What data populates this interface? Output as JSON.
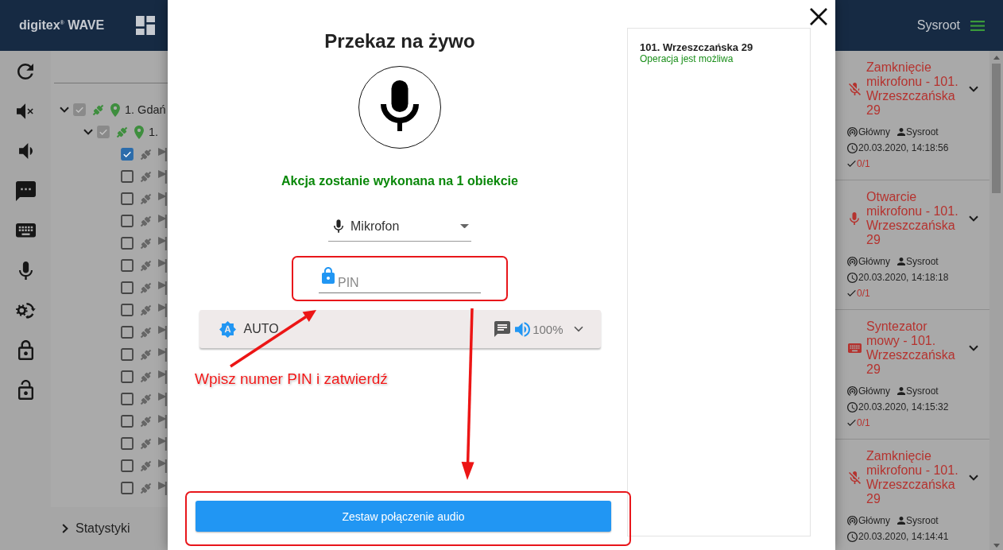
{
  "header": {
    "logo": "digitex$^{®}$ WAVE",
    "user": "Sysroot"
  },
  "tree": [
    {
      "label": "1. Gdań",
      "kind": "location",
      "color": "#3e8e3e",
      "checked": true,
      "disabled": true,
      "expanded": true,
      "children": [
        {
          "label": "1.",
          "kind": "location",
          "color": "#3e8e3e",
          "checked": true,
          "disabled": true,
          "expanded": true,
          "children": [
            {
              "kind": "device",
              "color": "#666666",
              "checked": true,
              "disabled": false
            },
            {
              "kind": "device",
              "color": "#666666",
              "checked": false,
              "disabled": false
            },
            {
              "kind": "device",
              "color": "#666666",
              "checked": false,
              "disabled": false
            },
            {
              "kind": "device",
              "color": "#666666",
              "checked": false,
              "disabled": false
            },
            {
              "kind": "device",
              "color": "#666666",
              "checked": false,
              "disabled": false
            },
            {
              "kind": "device",
              "color": "#666666",
              "checked": false,
              "disabled": false
            },
            {
              "kind": "device",
              "color": "#666666",
              "checked": false,
              "disabled": false
            },
            {
              "kind": "device",
              "color": "#666666",
              "checked": false,
              "disabled": false
            },
            {
              "kind": "device",
              "color": "#666666",
              "checked": false,
              "disabled": false
            },
            {
              "kind": "device",
              "color": "#666666",
              "checked": false,
              "disabled": false
            },
            {
              "kind": "device",
              "color": "#666666",
              "checked": false,
              "disabled": false
            },
            {
              "kind": "device",
              "color": "#666666",
              "checked": false,
              "disabled": false
            },
            {
              "kind": "device",
              "color": "#666666",
              "checked": false,
              "disabled": false
            },
            {
              "kind": "device",
              "color": "#666666",
              "checked": false,
              "disabled": false
            },
            {
              "kind": "device",
              "color": "#666666",
              "checked": false,
              "disabled": false
            },
            {
              "kind": "device",
              "color": "#666666",
              "checked": false,
              "disabled": false
            }
          ]
        }
      ]
    }
  ],
  "statistics": {
    "label": "Statystyki",
    "expanded": false
  },
  "modal": {
    "title": "Przekaz na żywo",
    "summary": "Akcja zostanie wykonana na 1 obiekcie",
    "source": {
      "value": "Mikrofon"
    },
    "pin": {
      "placeholder": "PIN"
    },
    "mode": {
      "label": "AUTO",
      "volume": "100%"
    },
    "submit": "Zestaw połączenie audio",
    "targets": [
      {
        "name": "101. Wrzeszczańska 29",
        "status": "Operacja jest możliwa"
      }
    ]
  },
  "annotation": {
    "text": "Wpisz numer PIN i zatwierdź"
  },
  "events": [
    {
      "kind": "mic_off",
      "title": "Zamknięcie mikrofonu - 101. Wrzeszczańska 29",
      "channel": "Główny",
      "user": "Sysroot",
      "time": "20.03.2020, 14:18:56",
      "confirmed": "0/1"
    },
    {
      "kind": "mic",
      "title": "Otwarcie mikrofonu - 101. Wrzeszczańska 29",
      "channel": "Główny",
      "user": "Sysroot",
      "time": "20.03.2020, 14:18:18",
      "confirmed": "0/1"
    },
    {
      "kind": "keyboard",
      "title": "Syntezator mowy - 101. Wrzeszczańska 29",
      "channel": "Główny",
      "user": "Sysroot",
      "time": "20.03.2020, 14:15:32",
      "confirmed": "0/1"
    },
    {
      "kind": "mic_off",
      "title": "Zamknięcie mikrofonu - 101. Wrzeszczańska 29",
      "channel": "Główny",
      "user": "Sysroot",
      "time": "20.03.2020, 14:14:41"
    }
  ]
}
